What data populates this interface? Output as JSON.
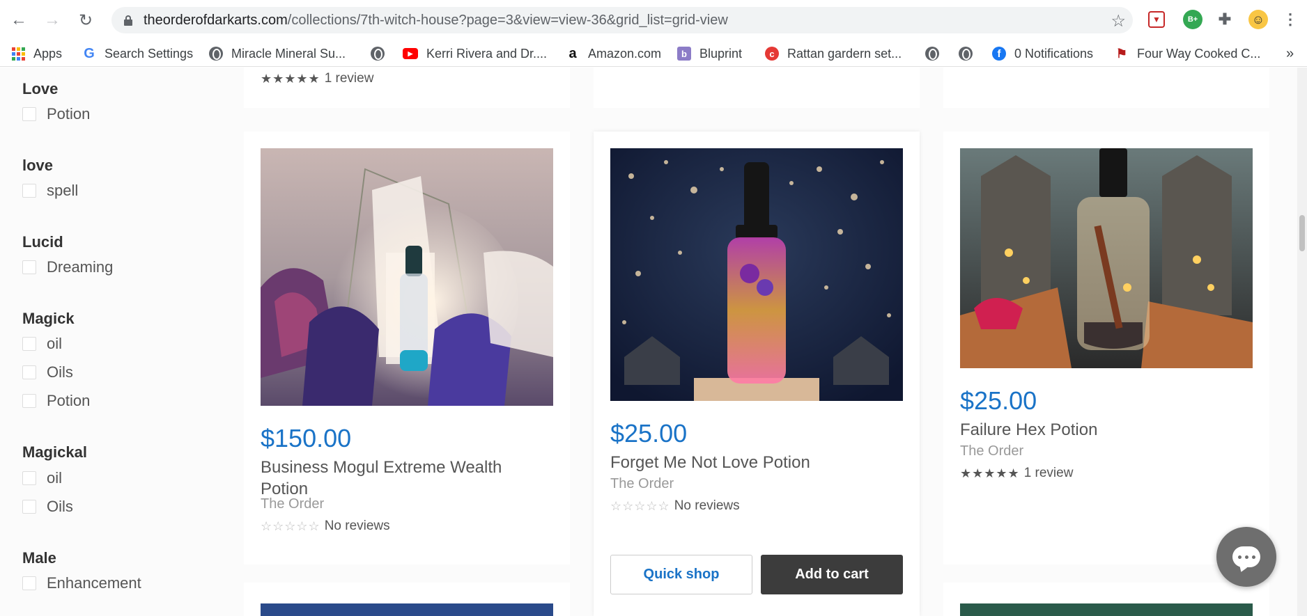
{
  "browser": {
    "url_host": "theorderofdarkarts.com",
    "url_path": "/collections/7th-witch-house?page=3&view=view-36&grid_list=grid-view",
    "bookmarks": [
      {
        "label": "Apps",
        "icon": "apps-grid-icon"
      },
      {
        "label": "Search Settings",
        "icon": "google-icon"
      },
      {
        "label": "Miracle Mineral Su...",
        "icon": "globe-icon"
      },
      {
        "label": "",
        "icon": "globe-icon"
      },
      {
        "label": "Kerri Rivera and Dr....",
        "icon": "youtube-icon"
      },
      {
        "label": "Amazon.com",
        "icon": "amazon-icon"
      },
      {
        "label": "Bluprint",
        "icon": "bluprint-icon"
      },
      {
        "label": "Rattan gardern set...",
        "icon": "rattan-icon"
      },
      {
        "label": "",
        "icon": "globe-icon"
      },
      {
        "label": "",
        "icon": "globe-icon"
      },
      {
        "label": "0 Notifications",
        "icon": "facebook-icon"
      },
      {
        "label": "Four Way Cooked C...",
        "icon": "recipe-icon"
      }
    ],
    "more_bookmarks": "»",
    "ext_b_plus": "B+"
  },
  "sidebar": {
    "groups": [
      {
        "title": "Love",
        "options": [
          "Potion"
        ]
      },
      {
        "title": "love",
        "options": [
          "spell"
        ]
      },
      {
        "title": "Lucid",
        "options": [
          "Dreaming"
        ]
      },
      {
        "title": "Magick",
        "options": [
          "oil",
          "Oils",
          "Potion"
        ]
      },
      {
        "title": "Magickal",
        "options": [
          "oil",
          "Oils"
        ]
      },
      {
        "title": "Male",
        "options": [
          "Enhancement"
        ]
      }
    ]
  },
  "top_row": {
    "rating_text": "1 review"
  },
  "products": [
    {
      "price": "$150.00",
      "title_line1": "Business Mogul Extreme Wealth",
      "title_line2": "Potion",
      "vendor": "The Order",
      "rating_text": "No reviews",
      "stars": 0
    },
    {
      "price": "$25.00",
      "title_line1": "Forget Me Not Love Potion",
      "vendor": "The Order",
      "rating_text": "No reviews",
      "stars": 0,
      "quick_shop": "Quick shop",
      "add_to_cart": "Add to cart"
    },
    {
      "price": "$25.00",
      "title_line1": "Failure Hex Potion",
      "vendor": "The Order",
      "rating_text": "1 review",
      "stars": 5
    }
  ],
  "colors": {
    "price": "#1a73c7",
    "cart_button": "#3c3c3c"
  }
}
